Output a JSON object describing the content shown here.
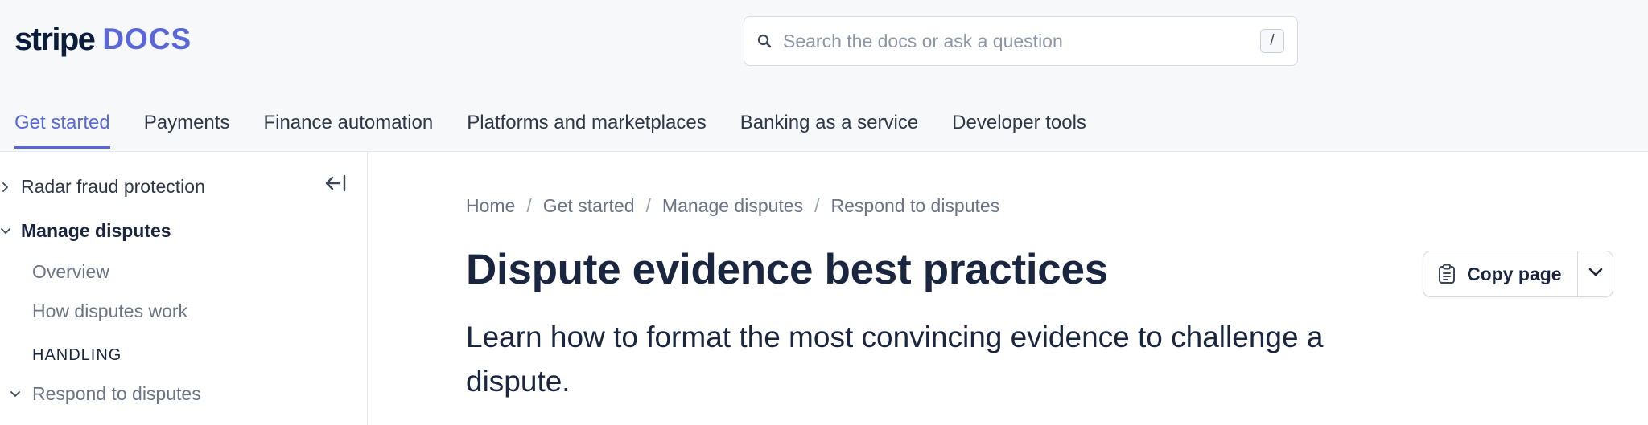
{
  "logo": {
    "brand": "stripe",
    "product": "DOCS"
  },
  "search": {
    "placeholder": "Search the docs or ask a question",
    "shortcut": "/"
  },
  "tabs": [
    {
      "label": "Get started",
      "active": true
    },
    {
      "label": "Payments"
    },
    {
      "label": "Finance automation"
    },
    {
      "label": "Platforms and marketplaces"
    },
    {
      "label": "Banking as a service"
    },
    {
      "label": "Developer tools"
    }
  ],
  "sidebar": {
    "items": [
      {
        "label": "Radar fraud protection",
        "expanded": false
      },
      {
        "label": "Manage disputes",
        "expanded": true
      },
      {
        "label": "Overview"
      },
      {
        "label": "How disputes work"
      },
      {
        "label": "HANDLING"
      },
      {
        "label": "Respond to disputes",
        "expanded": true
      }
    ]
  },
  "breadcrumb": {
    "items": [
      "Home",
      "Get started",
      "Manage disputes",
      "Respond to disputes"
    ],
    "separator": "/"
  },
  "page": {
    "title": "Dispute evidence best practices",
    "subtitle": "Learn how to format the most convincing evidence to challenge a dispute."
  },
  "copy_page": {
    "label": "Copy page"
  },
  "colors": {
    "accent": "#5a67d8",
    "text": "#1a2540",
    "muted": "#6b7385",
    "header_bg": "#f7f8fa",
    "border": "#e3e7ee"
  }
}
